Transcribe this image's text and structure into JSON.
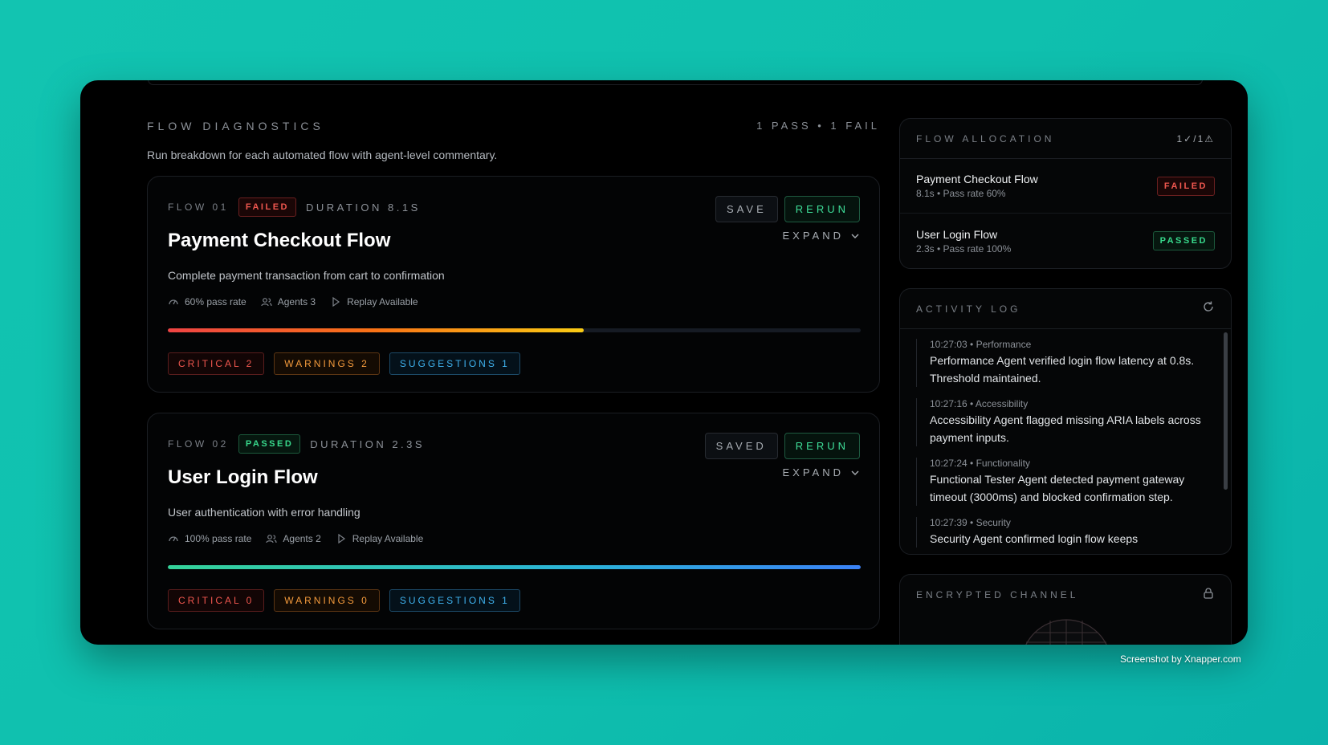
{
  "main": {
    "title": "FLOW DIAGNOSTICS",
    "count": "1 PASS • 1 FAIL",
    "description": "Run breakdown for each automated flow with agent-level commentary.",
    "flows": [
      {
        "num": "FLOW 01",
        "status": "FAILED",
        "duration": "DURATION 8.1S",
        "title": "Payment Checkout Flow",
        "description": "Complete payment transaction from cart to confirmation",
        "pass_rate": "60% pass rate",
        "agents": "Agents 3",
        "replay": "Replay Available",
        "progress": 0.6,
        "save_label": "SAVE",
        "rerun_label": "RERUN",
        "expand_label": "EXPAND",
        "critical": "CRITICAL 2",
        "warnings": "WARNINGS 2",
        "suggestions": "SUGGESTIONS 1"
      },
      {
        "num": "FLOW 02",
        "status": "PASSED",
        "duration": "DURATION 2.3S",
        "title": "User Login Flow",
        "description": "User authentication with error handling",
        "pass_rate": "100% pass rate",
        "agents": "Agents 2",
        "replay": "Replay Available",
        "progress": 1.0,
        "save_label": "SAVED",
        "rerun_label": "RERUN",
        "expand_label": "EXPAND",
        "critical": "CRITICAL 0",
        "warnings": "WARNINGS 0",
        "suggestions": "SUGGESTIONS 1"
      }
    ]
  },
  "allocation": {
    "title": "FLOW ALLOCATION",
    "count": "1✓/1⚠",
    "items": [
      {
        "name": "Payment Checkout Flow",
        "sub": "8.1s • Pass rate 60%",
        "status": "FAILED"
      },
      {
        "name": "User Login Flow",
        "sub": "2.3s • Pass rate 100%",
        "status": "PASSED"
      }
    ]
  },
  "activity": {
    "title": "ACTIVITY LOG",
    "entries": [
      {
        "time": "10:27:03 • Performance",
        "msg": "Performance Agent verified login flow latency at 0.8s. Threshold maintained."
      },
      {
        "time": "10:27:16 • Accessibility",
        "msg": "Accessibility Agent flagged missing ARIA labels across payment inputs."
      },
      {
        "time": "10:27:24 • Functionality",
        "msg": "Functional Tester Agent detected payment gateway timeout (3000ms) and blocked confirmation step."
      },
      {
        "time": "10:27:39 • Security",
        "msg": "Security Agent confirmed login flow keeps"
      }
    ]
  },
  "encrypted": {
    "title": "ENCRYPTED CHANNEL"
  },
  "credit": "Screenshot by Xnapper.com",
  "colors": {
    "background": "#12c4b1",
    "failed": "#f0574f",
    "passed": "#38d98c",
    "warning": "#f39a3c",
    "suggestion": "#3fb2ee"
  }
}
